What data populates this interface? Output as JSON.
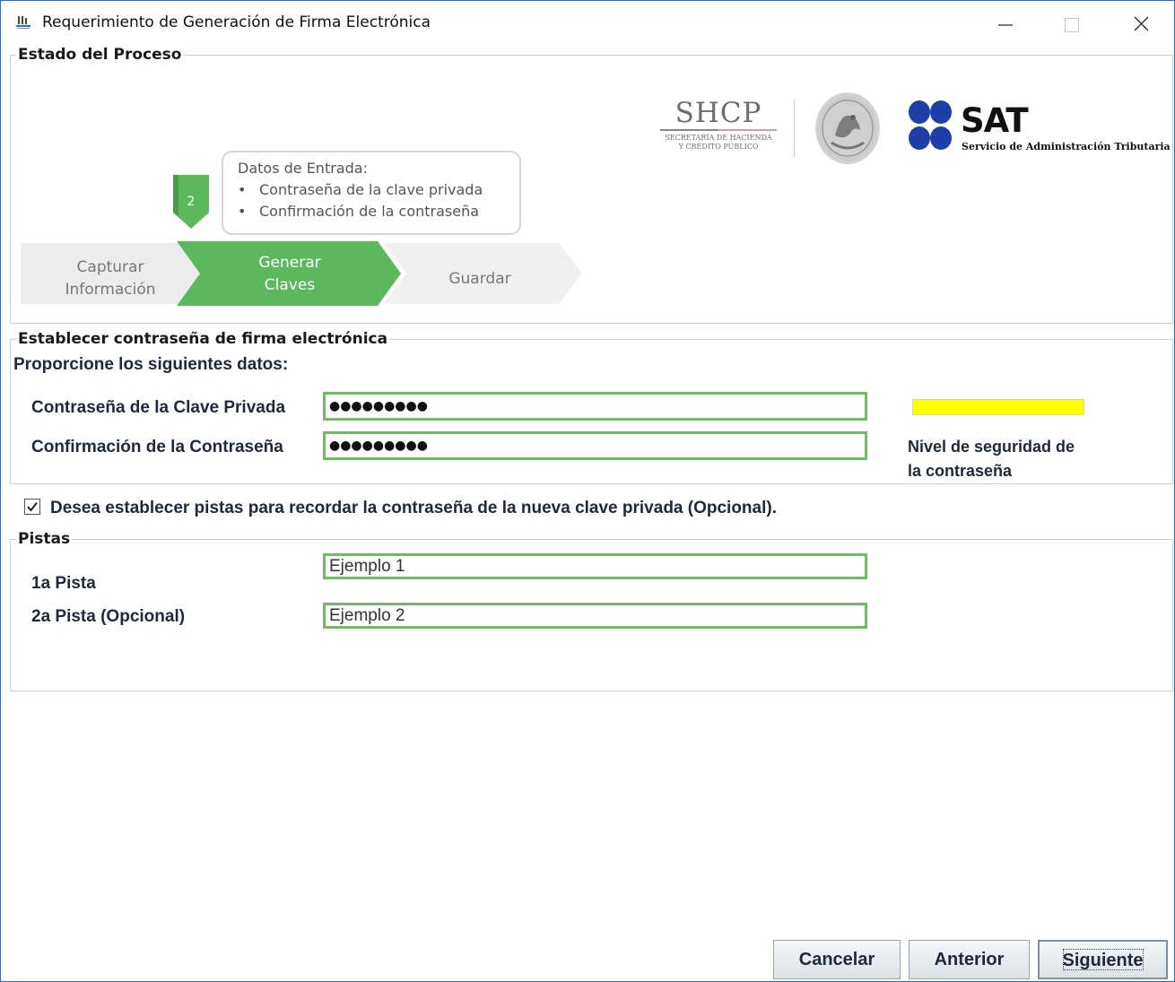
{
  "window": {
    "title": "Requerimiento de Generación de Firma Electrónica"
  },
  "process": {
    "group_title": "Estado del Proceso",
    "step_number": "2",
    "callout": {
      "title": "Datos de Entrada:",
      "bullet": "•",
      "items": [
        "Contraseña de la clave privada",
        "Confirmación de la contraseña"
      ]
    },
    "steps": [
      {
        "line1": "Capturar",
        "line2": "Información",
        "state": "done"
      },
      {
        "line1": "Generar",
        "line2": "Claves",
        "state": "active"
      },
      {
        "line1": "Guardar",
        "line2": "",
        "state": "pending"
      }
    ],
    "active_color": "#5cb85c"
  },
  "logos": {
    "shcp_name": "SHCP",
    "shcp_sub1": "Secretaría de Hacienda",
    "shcp_sub2": "y Crédito Público",
    "sat_name": "SAT",
    "sat_sub": "Servicio de Administración Tributaria",
    "sat_color": "#1f3fa8"
  },
  "password_section": {
    "group_title": "Establecer contraseña de firma electrónica",
    "instruction": "Proporcione los siguientes datos:",
    "private_key_label": "Contraseña de la Clave Privada",
    "private_key_value": "●●●●●●●●●",
    "confirm_label": "Confirmación de la Contraseña",
    "confirm_value": "●●●●●●●●●",
    "strength_label_line1": "Nivel de seguridad de",
    "strength_label_line2": "la contraseña",
    "strength_color": "#ffff00"
  },
  "hints_option": {
    "checked": true,
    "label": "Desea establecer pistas para recordar la contraseña de la nueva clave privada (Opcional)."
  },
  "hints": {
    "group_title": "Pistas",
    "hint1_label": "1a Pista",
    "hint1_value": "Ejemplo 1",
    "hint2_label": "2a Pista (Opcional)",
    "hint2_value": "Ejemplo 2"
  },
  "buttons": {
    "cancel": "Cancelar",
    "back": "Anterior",
    "next": "Siguiente"
  }
}
